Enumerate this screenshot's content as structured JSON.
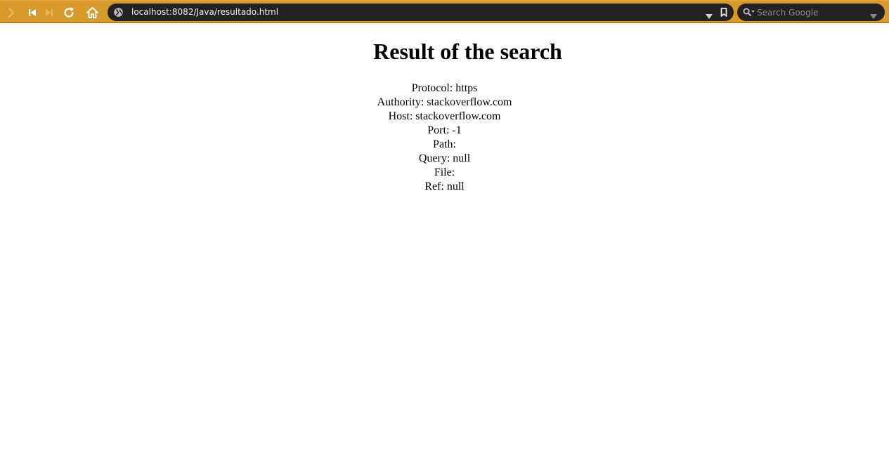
{
  "browser": {
    "url": "localhost:8082/Java/resultado.html",
    "search_placeholder": "Search Google",
    "icons": {
      "forward": "forward-arrow-icon",
      "rewind": "rewind-icon",
      "fast_forward": "fast-forward-icon",
      "reload": "reload-icon",
      "home": "home-icon",
      "site_info": "globe-icon",
      "dropdown": "chevron-down-icon",
      "bookmark": "bookmark-icon",
      "search": "search-icon"
    },
    "colors": {
      "toolbar": "#d89a2a",
      "field_bg": "#222222"
    }
  },
  "page": {
    "title": "Result of the search",
    "lines": [
      "Protocol: https",
      "Authority: stackoverflow.com",
      "Host: stackoverflow.com",
      "Port: -1",
      "Path:",
      "Query: null",
      "File:",
      "Ref: null"
    ]
  }
}
